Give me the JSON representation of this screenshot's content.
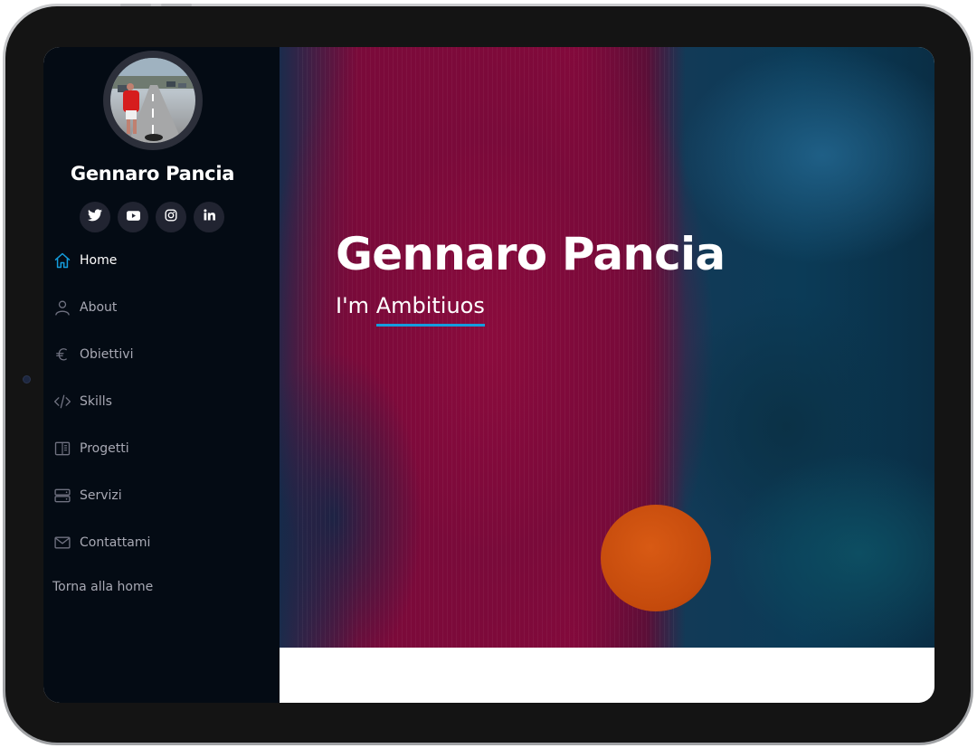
{
  "profile": {
    "name": "Gennaro Pancia"
  },
  "socials": [
    {
      "name": "twitter",
      "icon": "twitter-icon"
    },
    {
      "name": "youtube",
      "icon": "youtube-icon"
    },
    {
      "name": "instagram",
      "icon": "instagram-icon"
    },
    {
      "name": "linkedin",
      "icon": "linkedin-icon"
    }
  ],
  "nav": {
    "items": [
      {
        "label": "Home",
        "icon": "home-icon",
        "active": true
      },
      {
        "label": "About",
        "icon": "person-icon",
        "active": false
      },
      {
        "label": "Obiettivi",
        "icon": "euro-icon",
        "active": false
      },
      {
        "label": "Skills",
        "icon": "code-icon",
        "active": false
      },
      {
        "label": "Progetti",
        "icon": "layout-icon",
        "active": false
      },
      {
        "label": "Servizi",
        "icon": "server-icon",
        "active": false
      },
      {
        "label": "Contattami",
        "icon": "envelope-icon",
        "active": false
      }
    ],
    "back_label": "Torna alla home"
  },
  "hero": {
    "title": "Gennaro Pancia",
    "prefix": "I'm ",
    "typed": "Ambitiuos"
  },
  "colors": {
    "accent": "#149ddd",
    "sidebar_bg": "#040b14",
    "nav_text": "#a8a9b4"
  }
}
